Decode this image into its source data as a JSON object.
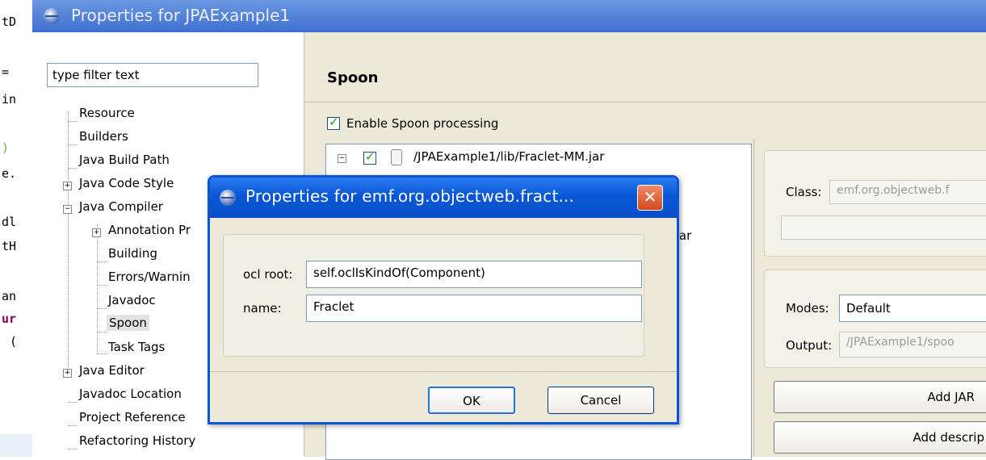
{
  "editor": {
    "fragments": [
      "tD",
      "=",
      "in",
      ")",
      "e.",
      "dl",
      "tH",
      "an",
      "ur",
      "("
    ]
  },
  "main_window": {
    "title": "Properties for JPAExample1",
    "filter": {
      "placeholder": "type filter text",
      "value": "type filter text"
    },
    "tree": {
      "resource": "Resource",
      "builders": "Builders",
      "java_build_path": "Java Build Path",
      "java_code_style": "Java Code Style",
      "java_compiler": "Java Compiler",
      "annotation_processing": "Annotation Pr",
      "building": "Building",
      "errors_warnings": "Errors/Warnin",
      "javadoc": "Javadoc",
      "spoon": "Spoon",
      "task_tags": "Task Tags",
      "java_editor": "Java Editor",
      "javadoc_location": "Javadoc Location",
      "project_references": "Project Reference",
      "refactoring_history": "Refactoring History"
    },
    "page": {
      "heading": "Spoon",
      "enable_checkbox": {
        "label": "Enable Spoon processing",
        "checked": true
      },
      "processors": [
        {
          "path": "/JPAExample1/lib/Fraclet-MM.jar",
          "checked": true
        },
        {
          "path_suffix": ".jar"
        }
      ],
      "class_label": "Class:",
      "class_value": "emf.org.objectweb.f",
      "modes_label": "Modes:",
      "modes_value": "Default",
      "output_label": "Output:",
      "output_value": "/JPAExample1/spoo",
      "add_jar_button": "Add JAR",
      "add_descriptor_button": "Add descrip"
    }
  },
  "dialog": {
    "title": "Properties for emf.org.objectweb.fract...",
    "ocl_root_label": "ocl root:",
    "ocl_root_value": "self.oclIsKindOf(Component)",
    "name_label": "name:",
    "name_value": "Fraclet",
    "ok_button": "OK",
    "cancel_button": "Cancel"
  },
  "colors": {
    "xp_blue": "#0a55d8",
    "dialog_face": "#ece9d8",
    "close_red": "#d24a1c",
    "inactive_title": "#6b98e2"
  }
}
